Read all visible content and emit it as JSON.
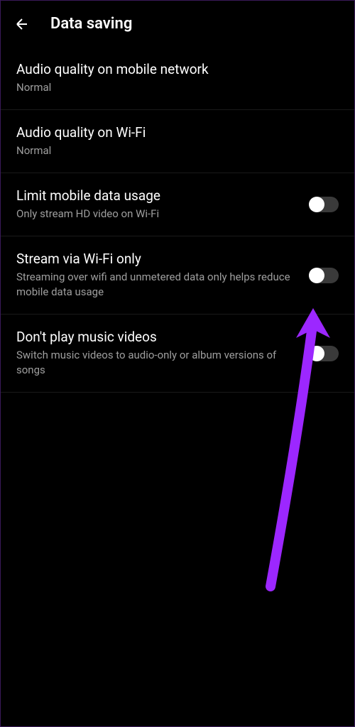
{
  "header": {
    "title": "Data saving"
  },
  "settings": [
    {
      "title": "Audio quality on mobile network",
      "subtitle": "Normal",
      "hasToggle": false
    },
    {
      "title": "Audio quality on Wi-Fi",
      "subtitle": "Normal",
      "hasToggle": false
    },
    {
      "title": "Limit mobile data usage",
      "subtitle": "Only stream HD video on Wi-Fi",
      "hasToggle": true,
      "toggleOn": false
    },
    {
      "title": "Stream via Wi-Fi only",
      "subtitle": "Streaming over wifi and unmetered data only helps reduce mobile data usage",
      "hasToggle": true,
      "toggleOn": false
    },
    {
      "title": "Don't play music videos",
      "subtitle": "Switch music videos to audio-only or album versions of songs",
      "hasToggle": true,
      "toggleOn": false
    }
  ],
  "annotation": {
    "arrowColor": "#9c27ff"
  }
}
